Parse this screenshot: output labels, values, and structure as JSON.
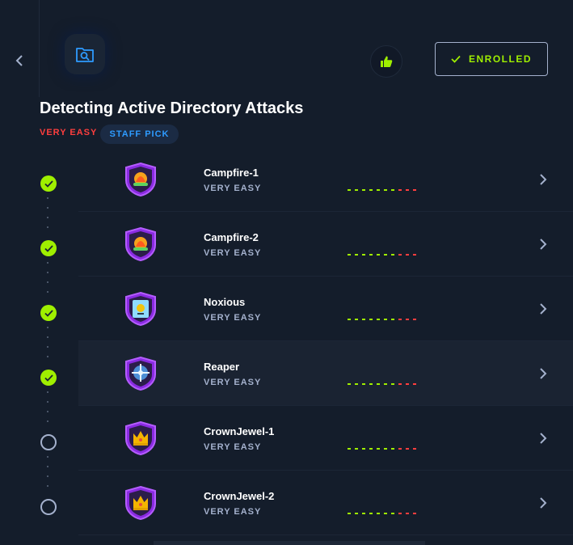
{
  "header": {
    "back_icon": "chevron-left-icon",
    "module_icon": "folder-search-icon",
    "like_icon": "thumbs-up-icon",
    "enrolled_label": "ENROLLED",
    "title": "Detecting Active Directory Attacks",
    "difficulty": "VERY EASY",
    "tag": "STAFF PICK"
  },
  "colors": {
    "background": "#141d2b",
    "accent_green": "#9fef00",
    "difficulty_red": "#ff3e3e",
    "staff_pick_blue": "#2e9bff",
    "muted_text": "#a4b1cd"
  },
  "modules": [
    {
      "name": "Campfire-1",
      "difficulty": "VERY EASY",
      "completed": true,
      "badge": "campfire-badge-icon"
    },
    {
      "name": "Campfire-2",
      "difficulty": "VERY EASY",
      "completed": true,
      "badge": "campfire-badge-icon"
    },
    {
      "name": "Noxious",
      "difficulty": "VERY EASY",
      "completed": true,
      "badge": "biohazard-badge-icon"
    },
    {
      "name": "Reaper",
      "difficulty": "VERY EASY",
      "completed": true,
      "badge": "crosshair-badge-icon"
    },
    {
      "name": "CrownJewel-1",
      "difficulty": "VERY EASY",
      "completed": false,
      "badge": "crown-badge-icon"
    },
    {
      "name": "CrownJewel-2",
      "difficulty": "VERY EASY",
      "completed": false,
      "badge": "crown-badge-icon"
    }
  ]
}
